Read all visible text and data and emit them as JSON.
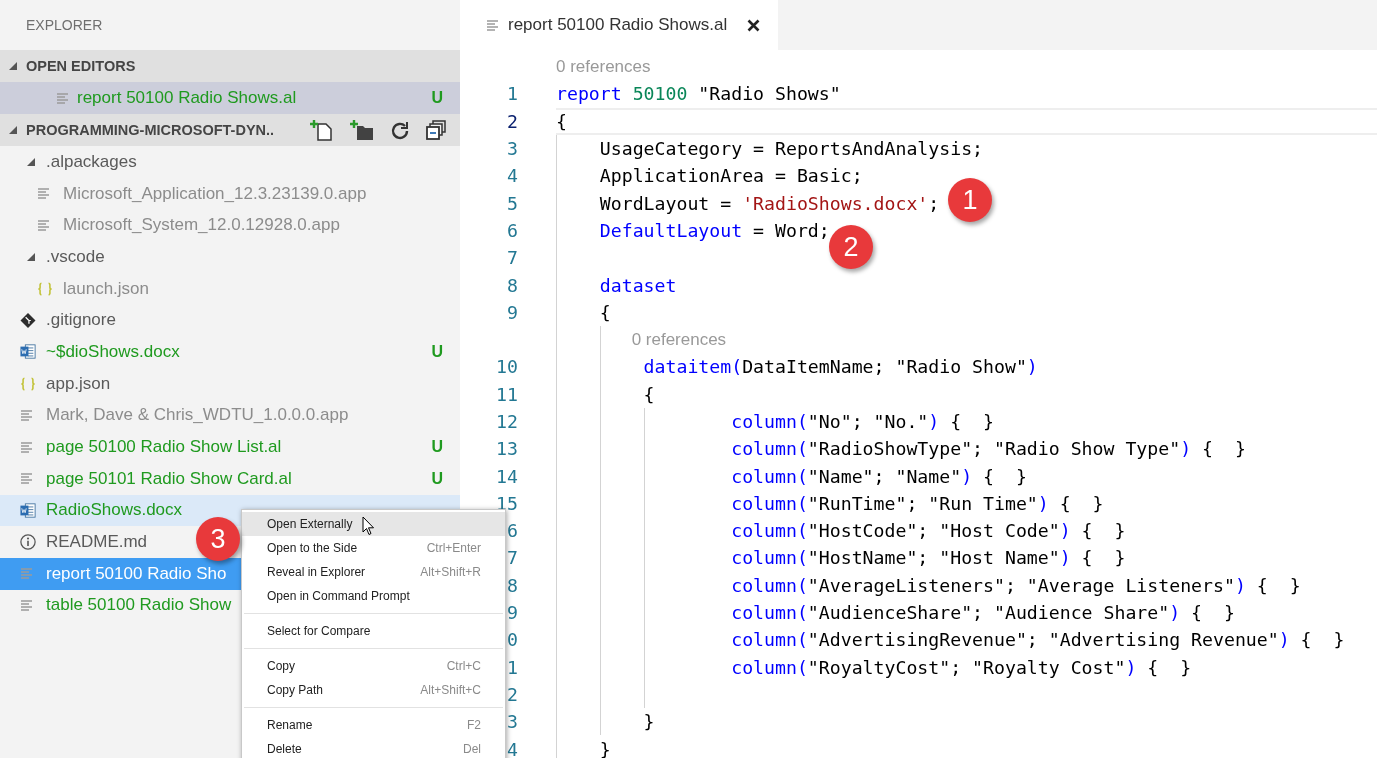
{
  "sidebar": {
    "title": "EXPLORER",
    "open_editors": {
      "title": "OPEN EDITORS",
      "expanded": true,
      "items": [
        {
          "kind": "text-file",
          "label": "report 50100 Radio Shows.al",
          "color": "#1f9a1f",
          "badge": "U",
          "selected": true
        }
      ]
    },
    "project": {
      "title": "PROGRAMMING-MICROSOFT-DYN..",
      "expanded": true,
      "items": [
        {
          "kind": "folder",
          "label": ".alpackages",
          "color": "#5a5a5a",
          "expanded": true,
          "selected": false,
          "highlighted": false,
          "children": [
            {
              "kind": "text-file",
              "label": "Microsoft_Application_12.3.23139.0.app",
              "color": "#8c8c8c",
              "selected": false,
              "highlighted": false
            },
            {
              "kind": "text-file",
              "label": "Microsoft_System_12.0.12928.0.app",
              "color": "#8c8c8c",
              "selected": false,
              "highlighted": false
            }
          ]
        },
        {
          "kind": "folder",
          "label": ".vscode",
          "color": "#5a5a5a",
          "expanded": true,
          "selected": false,
          "highlighted": false,
          "children": [
            {
              "kind": "json-file",
              "label": "launch.json",
              "color": "#8c8c8c",
              "selected": false,
              "highlighted": false
            }
          ]
        },
        {
          "kind": "git-file",
          "label": ".gitignore",
          "color": "#5a5a5a",
          "selected": false,
          "highlighted": false
        },
        {
          "kind": "word-file",
          "label": "~$dioShows.docx",
          "color": "#1f9a1f",
          "badge": "U",
          "selected": false,
          "highlighted": false
        },
        {
          "kind": "json-file",
          "label": "app.json",
          "color": "#5a5a5a",
          "selected": false,
          "highlighted": false
        },
        {
          "kind": "text-file",
          "label": "Mark, Dave & Chris_WDTU_1.0.0.0.app",
          "color": "#8c8c8c",
          "selected": false,
          "highlighted": false
        },
        {
          "kind": "text-file",
          "label": "page 50100 Radio Show List.al",
          "color": "#1f9a1f",
          "badge": "U",
          "selected": false,
          "highlighted": false
        },
        {
          "kind": "text-file",
          "label": "page 50101 Radio Show Card.al",
          "color": "#1f9a1f",
          "badge": "U",
          "selected": false,
          "highlighted": false
        },
        {
          "kind": "word-file",
          "label": "RadioShows.docx",
          "color": "#1f9a1f",
          "selected": false,
          "highlighted": true
        },
        {
          "kind": "info-file",
          "label": "README.md",
          "color": "#5a5a5a",
          "selected": false,
          "highlighted": false
        },
        {
          "kind": "text-file",
          "label": "report 50100 Radio Sho",
          "selected": true,
          "highlighted": false
        },
        {
          "kind": "text-file",
          "label": "table 50100 Radio Show",
          "color": "#1f9a1f",
          "selected": false,
          "highlighted": false
        }
      ]
    }
  },
  "editor": {
    "tab": {
      "label": "report 50100 Radio Shows.al",
      "active": true
    },
    "lines": [
      {
        "kind": "codelens",
        "text": "0 references"
      },
      {
        "kind": "code",
        "number": "1",
        "current": false,
        "tokens": [
          {
            "kind": "kw",
            "text": "report "
          },
          {
            "kind": "num",
            "text": "50100 "
          },
          {
            "kind": "plain",
            "text": "\"Radio Shows\""
          }
        ]
      },
      {
        "kind": "code",
        "number": "2",
        "current": true,
        "tokens": [
          {
            "kind": "plain",
            "text": "{"
          }
        ],
        "children": [
          {
            "kind": "code",
            "number": "3",
            "current": false,
            "tokens": [
              {
                "kind": "plain",
                "text": "UsageCategory = ReportsAndAnalysis;"
              }
            ]
          },
          {
            "kind": "code",
            "number": "4",
            "current": false,
            "tokens": [
              {
                "kind": "plain",
                "text": "ApplicationArea = Basic;"
              }
            ]
          },
          {
            "kind": "code",
            "number": "5",
            "current": false,
            "tokens": [
              {
                "kind": "plain",
                "text": "WordLayout = "
              },
              {
                "kind": "str",
                "text": "'RadioShows.docx'"
              },
              {
                "kind": "plain",
                "text": ";"
              }
            ]
          },
          {
            "kind": "code",
            "number": "6",
            "current": false,
            "tokens": [
              {
                "kind": "kw",
                "text": "DefaultLayout"
              },
              {
                "kind": "plain",
                "text": " = Word;"
              }
            ]
          },
          {
            "kind": "code",
            "number": "7",
            "current": false
          },
          {
            "kind": "code",
            "number": "8",
            "current": false,
            "tokens": [
              {
                "kind": "kw",
                "text": "dataset"
              }
            ]
          },
          {
            "kind": "code",
            "number": "9",
            "current": false,
            "tokens": [
              {
                "kind": "plain",
                "text": "{"
              }
            ],
            "children": [
              {
                "kind": "codelens",
                "text": "0 references"
              },
              {
                "kind": "code",
                "number": "10",
                "current": false,
                "tokens": [
                  {
                    "kind": "kw",
                    "text": "dataitem("
                  },
                  {
                    "kind": "plain",
                    "text": "DataItemName; \"Radio Show\""
                  },
                  {
                    "kind": "kw",
                    "text": ")"
                  }
                ]
              },
              {
                "kind": "code",
                "number": "11",
                "current": false,
                "tokens": [
                  {
                    "kind": "plain",
                    "text": "{"
                  }
                ],
                "children": [
                  {
                    "kind": "code",
                    "number": "12",
                    "current": false,
                    "tokens": [
                      {
                        "kind": "kw",
                        "text": "column("
                      },
                      {
                        "kind": "plain",
                        "text": "\"No\"; \"No.\""
                      },
                      {
                        "kind": "kw",
                        "text": ")"
                      },
                      {
                        "kind": "plain",
                        "text": " {  }"
                      }
                    ]
                  },
                  {
                    "kind": "code",
                    "number": "13",
                    "current": false,
                    "tokens": [
                      {
                        "kind": "kw",
                        "text": "column("
                      },
                      {
                        "kind": "plain",
                        "text": "\"RadioShowType\"; \"Radio Show Type\""
                      },
                      {
                        "kind": "kw",
                        "text": ")"
                      },
                      {
                        "kind": "plain",
                        "text": " {  }"
                      }
                    ]
                  },
                  {
                    "kind": "code",
                    "number": "14",
                    "current": false,
                    "tokens": [
                      {
                        "kind": "kw",
                        "text": "column("
                      },
                      {
                        "kind": "plain",
                        "text": "\"Name\"; \"Name\""
                      },
                      {
                        "kind": "kw",
                        "text": ")"
                      },
                      {
                        "kind": "plain",
                        "text": " {  }"
                      }
                    ]
                  },
                  {
                    "kind": "code",
                    "number": "15",
                    "current": false,
                    "tokens": [
                      {
                        "kind": "kw",
                        "text": "column("
                      },
                      {
                        "kind": "plain",
                        "text": "\"RunTime\"; \"Run Time\""
                      },
                      {
                        "kind": "kw",
                        "text": ")"
                      },
                      {
                        "kind": "plain",
                        "text": " {  }"
                      }
                    ]
                  },
                  {
                    "kind": "code",
                    "number": "6",
                    "current": false,
                    "tokens": [
                      {
                        "kind": "kw",
                        "text": "column("
                      },
                      {
                        "kind": "plain",
                        "text": "\"HostCode\"; \"Host Code\""
                      },
                      {
                        "kind": "kw",
                        "text": ")"
                      },
                      {
                        "kind": "plain",
                        "text": " {  }"
                      }
                    ]
                  },
                  {
                    "kind": "code",
                    "number": "7",
                    "current": false,
                    "tokens": [
                      {
                        "kind": "kw",
                        "text": "column("
                      },
                      {
                        "kind": "plain",
                        "text": "\"HostName\"; \"Host Name\""
                      },
                      {
                        "kind": "kw",
                        "text": ")"
                      },
                      {
                        "kind": "plain",
                        "text": " {  }"
                      }
                    ]
                  },
                  {
                    "kind": "code",
                    "number": "8",
                    "current": false,
                    "tokens": [
                      {
                        "kind": "kw",
                        "text": "column("
                      },
                      {
                        "kind": "plain",
                        "text": "\"AverageListeners\"; \"Average Listeners\""
                      },
                      {
                        "kind": "kw",
                        "text": ")"
                      },
                      {
                        "kind": "plain",
                        "text": " {  }"
                      }
                    ]
                  },
                  {
                    "kind": "code",
                    "number": "9",
                    "current": false,
                    "tokens": [
                      {
                        "kind": "kw",
                        "text": "column("
                      },
                      {
                        "kind": "plain",
                        "text": "\"AudienceShare\"; \"Audience Share\""
                      },
                      {
                        "kind": "kw",
                        "text": ")"
                      },
                      {
                        "kind": "plain",
                        "text": " {  }"
                      }
                    ]
                  },
                  {
                    "kind": "code",
                    "number": "0",
                    "current": false,
                    "tokens": [
                      {
                        "kind": "kw",
                        "text": "column("
                      },
                      {
                        "kind": "plain",
                        "text": "\"AdvertisingRevenue\"; \"Advertising Revenue\""
                      },
                      {
                        "kind": "kw",
                        "text": ")"
                      },
                      {
                        "kind": "plain",
                        "text": " {  }"
                      }
                    ]
                  },
                  {
                    "kind": "code",
                    "number": "1",
                    "current": false,
                    "tokens": [
                      {
                        "kind": "kw",
                        "text": "column("
                      },
                      {
                        "kind": "plain",
                        "text": "\"RoyaltyCost\"; \"Royalty Cost\""
                      },
                      {
                        "kind": "kw",
                        "text": ")"
                      },
                      {
                        "kind": "plain",
                        "text": " {  }"
                      }
                    ]
                  },
                  {
                    "kind": "code",
                    "number": "2",
                    "current": false
                  }
                ]
              },
              {
                "kind": "code",
                "number": "3",
                "current": false,
                "tokens": [
                  {
                    "kind": "plain",
                    "text": "}"
                  }
                ]
              }
            ]
          },
          {
            "kind": "code",
            "number": "4",
            "current": false,
            "tokens": [
              {
                "kind": "plain",
                "text": "}"
              }
            ]
          }
        ]
      }
    ]
  },
  "context_menu": {
    "groups": [
      [
        {
          "label": "Open Externally",
          "hovered": true
        },
        {
          "label": "Open to the Side",
          "shortcut": "Ctrl+Enter",
          "hovered": false
        },
        {
          "label": "Reveal in Explorer",
          "shortcut": "Alt+Shift+R",
          "hovered": false
        },
        {
          "label": "Open in Command Prompt",
          "hovered": false
        }
      ],
      [
        {
          "label": "Select for Compare",
          "hovered": false
        }
      ],
      [
        {
          "label": "Copy",
          "shortcut": "Ctrl+C",
          "hovered": false
        },
        {
          "label": "Copy Path",
          "shortcut": "Alt+Shift+C",
          "hovered": false
        }
      ],
      [
        {
          "label": "Rename",
          "shortcut": "F2",
          "hovered": false
        },
        {
          "label": "Delete",
          "shortcut": "Del",
          "hovered": false
        }
      ]
    ]
  },
  "callouts": [
    {
      "label": "1"
    },
    {
      "label": "2"
    },
    {
      "label": "3"
    }
  ]
}
